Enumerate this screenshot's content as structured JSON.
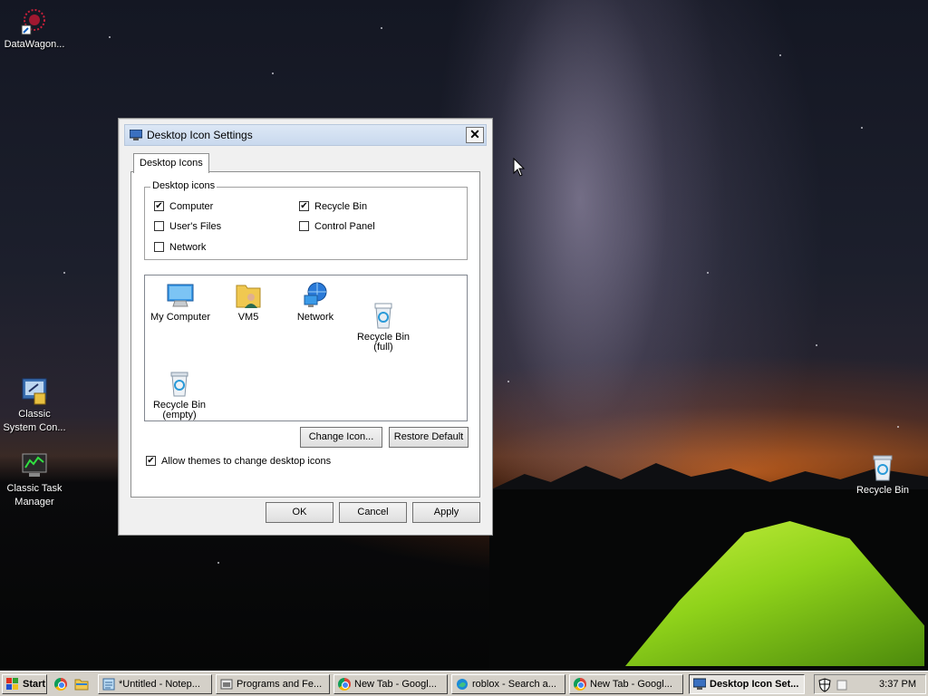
{
  "desktop": {
    "icons": [
      {
        "label": "DataWagon..."
      },
      {
        "label": "Classic\nSystem Con..."
      },
      {
        "label": "Classic Task\nManager"
      },
      {
        "label": "Recycle Bin"
      }
    ]
  },
  "dialog": {
    "title": "Desktop Icon Settings",
    "close_label": "✕",
    "tab_label": "Desktop Icons",
    "group_label": "Desktop icons",
    "checkboxes": [
      {
        "label": "Computer",
        "checked": true
      },
      {
        "label": "Recycle Bin",
        "checked": true
      },
      {
        "label": "User's Files",
        "checked": false
      },
      {
        "label": "Control Panel",
        "checked": false
      },
      {
        "label": "Network",
        "checked": false
      }
    ],
    "icon_list": [
      {
        "label": "My Computer",
        "icon": "computer-icon"
      },
      {
        "label": "VM5",
        "icon": "user-files-icon"
      },
      {
        "label": "Network",
        "icon": "network-icon"
      },
      {
        "label": "Recycle Bin\n(full)",
        "icon": "recycle-bin-full-icon"
      },
      {
        "label": "Recycle Bin\n(empty)",
        "icon": "recycle-bin-empty-icon"
      }
    ],
    "change_icon_label": "Change Icon...",
    "restore_default_label": "Restore Default",
    "allow_themes": {
      "label": "Allow themes to change desktop icons",
      "checked": true
    },
    "ok_label": "OK",
    "cancel_label": "Cancel",
    "apply_label": "Apply"
  },
  "taskbar": {
    "start_label": "Start",
    "items": [
      {
        "label": "*Untitled - Notep...",
        "icon": "notepad-icon",
        "active": false
      },
      {
        "label": "Programs and Fe...",
        "icon": "programs-icon",
        "active": false
      },
      {
        "label": "New Tab - Googl...",
        "icon": "chrome-icon",
        "active": false
      },
      {
        "label": "roblox - Search a...",
        "icon": "edge-icon",
        "active": false
      },
      {
        "label": "New Tab - Googl...",
        "icon": "chrome-icon",
        "active": false
      },
      {
        "label": "Desktop Icon Set...",
        "icon": "desktop-settings-icon",
        "active": true
      }
    ],
    "clock": "3:37 PM"
  }
}
